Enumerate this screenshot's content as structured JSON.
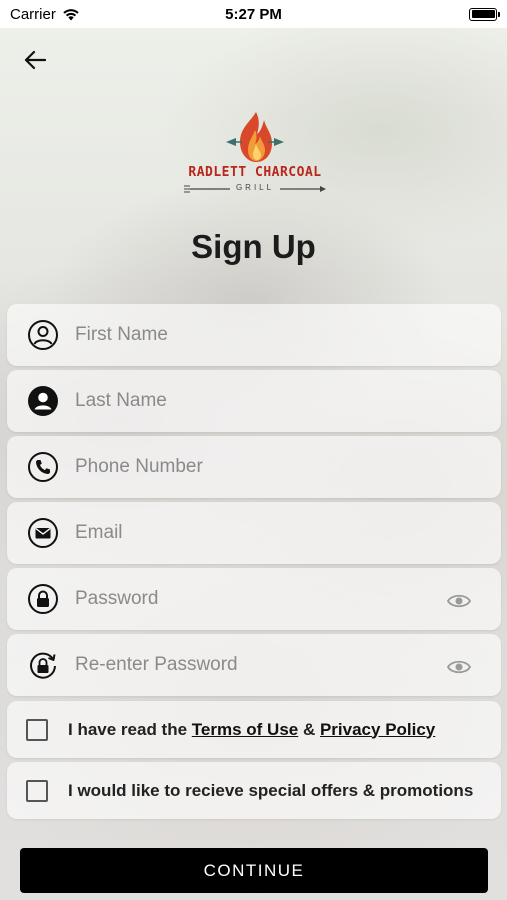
{
  "status_bar": {
    "carrier": "Carrier",
    "time": "5:27 PM",
    "wifi_icon": "wifi-icon",
    "battery_icon": "battery-icon"
  },
  "nav": {
    "back_icon": "arrow-left-icon"
  },
  "logo": {
    "name": "RADLETT CHARCOAL",
    "subtitle": "GRILL",
    "icon": "flame-icon",
    "brand_color": "#b8261c"
  },
  "page": {
    "title": "Sign Up"
  },
  "form": {
    "fields": [
      {
        "placeholder": "First Name",
        "value": "",
        "icon": "person-circle-icon"
      },
      {
        "placeholder": "Last Name",
        "value": "",
        "icon": "person-filled-icon"
      },
      {
        "placeholder": "Phone Number",
        "value": "",
        "icon": "phone-icon"
      },
      {
        "placeholder": "Email",
        "value": "",
        "icon": "envelope-icon"
      },
      {
        "placeholder": "Password",
        "value": "",
        "icon": "lock-icon",
        "trailing_icon": "eye-icon"
      },
      {
        "placeholder": "Re-enter Password",
        "value": "",
        "icon": "lock-rotate-icon",
        "trailing_icon": "eye-icon"
      }
    ],
    "terms": {
      "prefix": "I have read the ",
      "terms_link": "Terms of Use",
      "joiner": " & ",
      "privacy_link": "Privacy Policy",
      "checked": false
    },
    "offers": {
      "label": "I would like to recieve special offers & promotions",
      "checked": false
    },
    "continue_label": "CONTINUE"
  }
}
